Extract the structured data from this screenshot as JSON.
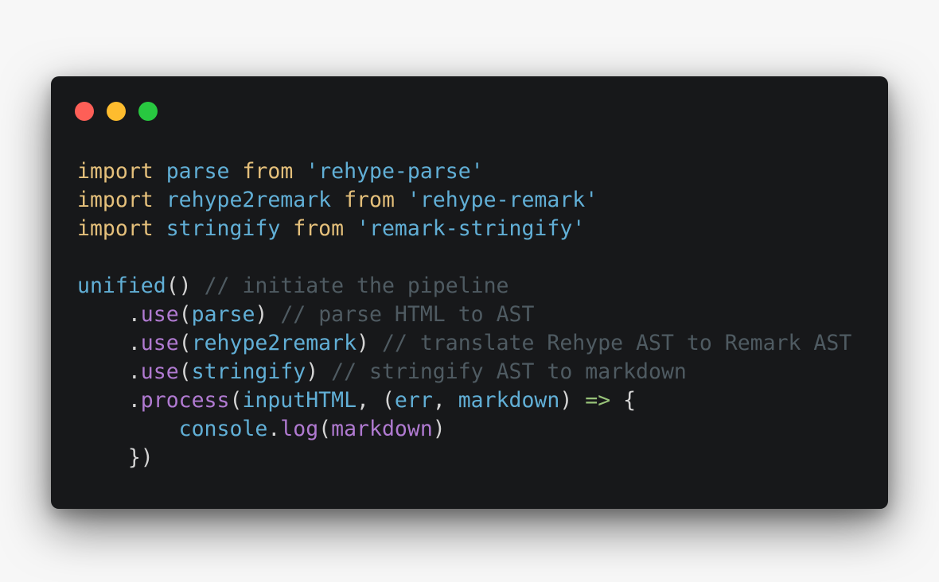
{
  "window": {
    "controls": [
      {
        "name": "close-button",
        "color": "#fe5f57"
      },
      {
        "name": "minimize-button",
        "color": "#febc2e"
      },
      {
        "name": "maximize-button",
        "color": "#28c840"
      }
    ]
  },
  "colors": {
    "background": "#17181a",
    "keyword": "#e5c07b",
    "identifier": "#61afd6",
    "method": "#b07ad1",
    "comment": "#4f5b62",
    "punctuation": "#d4d4d4",
    "arrow": "#98c379"
  },
  "code": {
    "lines": [
      [
        {
          "t": "import",
          "k": "keyword"
        },
        {
          "t": " ",
          "k": "punct"
        },
        {
          "t": "parse",
          "k": "ident"
        },
        {
          "t": " ",
          "k": "punct"
        },
        {
          "t": "from",
          "k": "keyword"
        },
        {
          "t": " ",
          "k": "punct"
        },
        {
          "t": "'rehype-parse'",
          "k": "string"
        }
      ],
      [
        {
          "t": "import",
          "k": "keyword"
        },
        {
          "t": " ",
          "k": "punct"
        },
        {
          "t": "rehype2remark",
          "k": "ident"
        },
        {
          "t": " ",
          "k": "punct"
        },
        {
          "t": "from",
          "k": "keyword"
        },
        {
          "t": " ",
          "k": "punct"
        },
        {
          "t": "'rehype-remark'",
          "k": "string"
        }
      ],
      [
        {
          "t": "import",
          "k": "keyword"
        },
        {
          "t": " ",
          "k": "punct"
        },
        {
          "t": "stringify",
          "k": "ident"
        },
        {
          "t": " ",
          "k": "punct"
        },
        {
          "t": "from",
          "k": "keyword"
        },
        {
          "t": " ",
          "k": "punct"
        },
        {
          "t": "'remark-stringify'",
          "k": "string"
        }
      ],
      [],
      [
        {
          "t": "unified",
          "k": "ident"
        },
        {
          "t": "()",
          "k": "punct"
        },
        {
          "t": " ",
          "k": "punct"
        },
        {
          "t": "// initiate the pipeline",
          "k": "comment"
        }
      ],
      [
        {
          "t": "    .",
          "k": "punct"
        },
        {
          "t": "use",
          "k": "method"
        },
        {
          "t": "(",
          "k": "punct"
        },
        {
          "t": "parse",
          "k": "ident"
        },
        {
          "t": ")",
          "k": "punct"
        },
        {
          "t": " ",
          "k": "punct"
        },
        {
          "t": "// parse HTML to AST",
          "k": "comment"
        }
      ],
      [
        {
          "t": "    .",
          "k": "punct"
        },
        {
          "t": "use",
          "k": "method"
        },
        {
          "t": "(",
          "k": "punct"
        },
        {
          "t": "rehype2remark",
          "k": "ident"
        },
        {
          "t": ")",
          "k": "punct"
        },
        {
          "t": " ",
          "k": "punct"
        },
        {
          "t": "// translate Rehype AST to Remark AST",
          "k": "comment"
        }
      ],
      [
        {
          "t": "    .",
          "k": "punct"
        },
        {
          "t": "use",
          "k": "method"
        },
        {
          "t": "(",
          "k": "punct"
        },
        {
          "t": "stringify",
          "k": "ident"
        },
        {
          "t": ")",
          "k": "punct"
        },
        {
          "t": " ",
          "k": "punct"
        },
        {
          "t": "// stringify AST to markdown",
          "k": "comment"
        }
      ],
      [
        {
          "t": "    .",
          "k": "punct"
        },
        {
          "t": "process",
          "k": "method"
        },
        {
          "t": "(",
          "k": "punct"
        },
        {
          "t": "inputHTML",
          "k": "ident"
        },
        {
          "t": ", (",
          "k": "punct"
        },
        {
          "t": "err",
          "k": "ident"
        },
        {
          "t": ", ",
          "k": "punct"
        },
        {
          "t": "markdown",
          "k": "ident"
        },
        {
          "t": ") ",
          "k": "punct"
        },
        {
          "t": "=>",
          "k": "arrow"
        },
        {
          "t": " {",
          "k": "punct"
        }
      ],
      [
        {
          "t": "        ",
          "k": "punct"
        },
        {
          "t": "console",
          "k": "ident"
        },
        {
          "t": ".",
          "k": "punct"
        },
        {
          "t": "log",
          "k": "method"
        },
        {
          "t": "(",
          "k": "punct"
        },
        {
          "t": "markdown",
          "k": "method"
        },
        {
          "t": ")",
          "k": "punct"
        }
      ],
      [
        {
          "t": "    })",
          "k": "punct"
        }
      ]
    ]
  }
}
